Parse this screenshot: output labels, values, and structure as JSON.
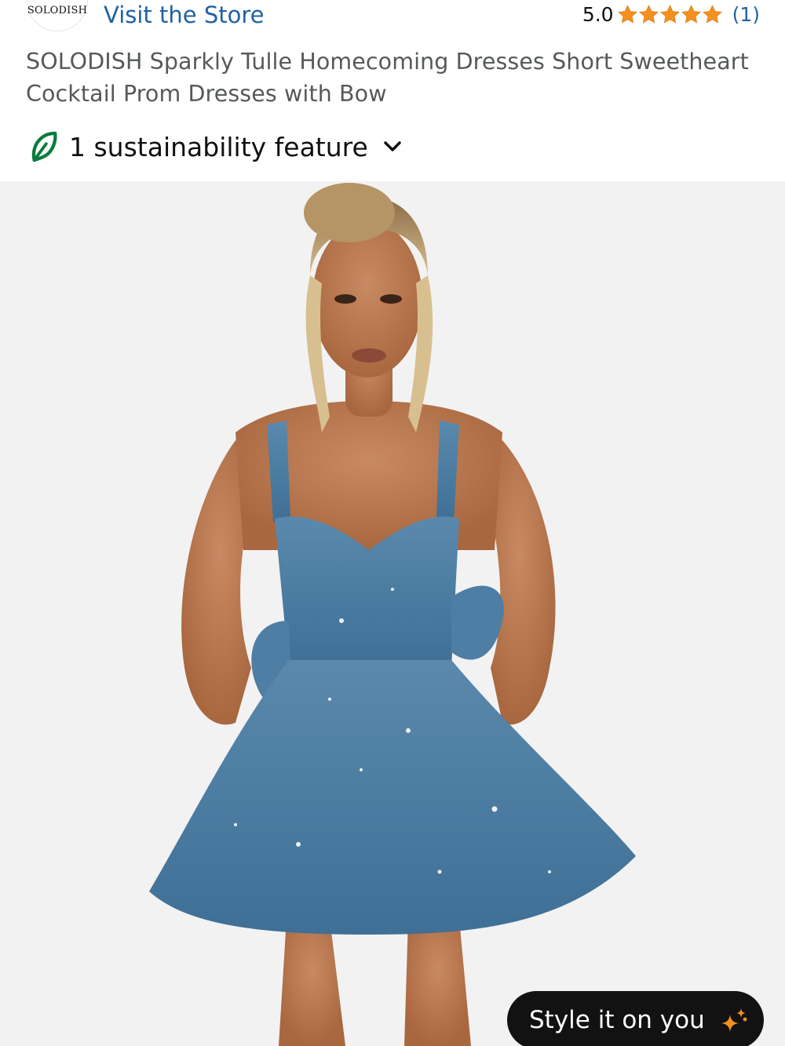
{
  "store": {
    "brand_logo_text": "SOLODISH",
    "visit_label": "Visit the Store",
    "rating_value": "5.0",
    "rating_stars": 5,
    "rating_count": "(1)"
  },
  "product": {
    "title": "SOLODISH Sparkly Tulle Homecoming Dresses Short Sweetheart Cocktail Prom Dresses with Bow"
  },
  "sustainability": {
    "label": "1 sustainability feature",
    "icon": "leaf-icon"
  },
  "style_button": {
    "label": "Style it on you",
    "icon": "sparkle-icon"
  },
  "colors": {
    "link": "#2162a1",
    "star": "#f4901e",
    "title_text": "#565959",
    "leaf": "#0b7b3c",
    "pill_bg": "#121212",
    "sparkle": "#f4901e",
    "image_bg": "#f2f2f2",
    "dress": "#4f7fa3"
  }
}
